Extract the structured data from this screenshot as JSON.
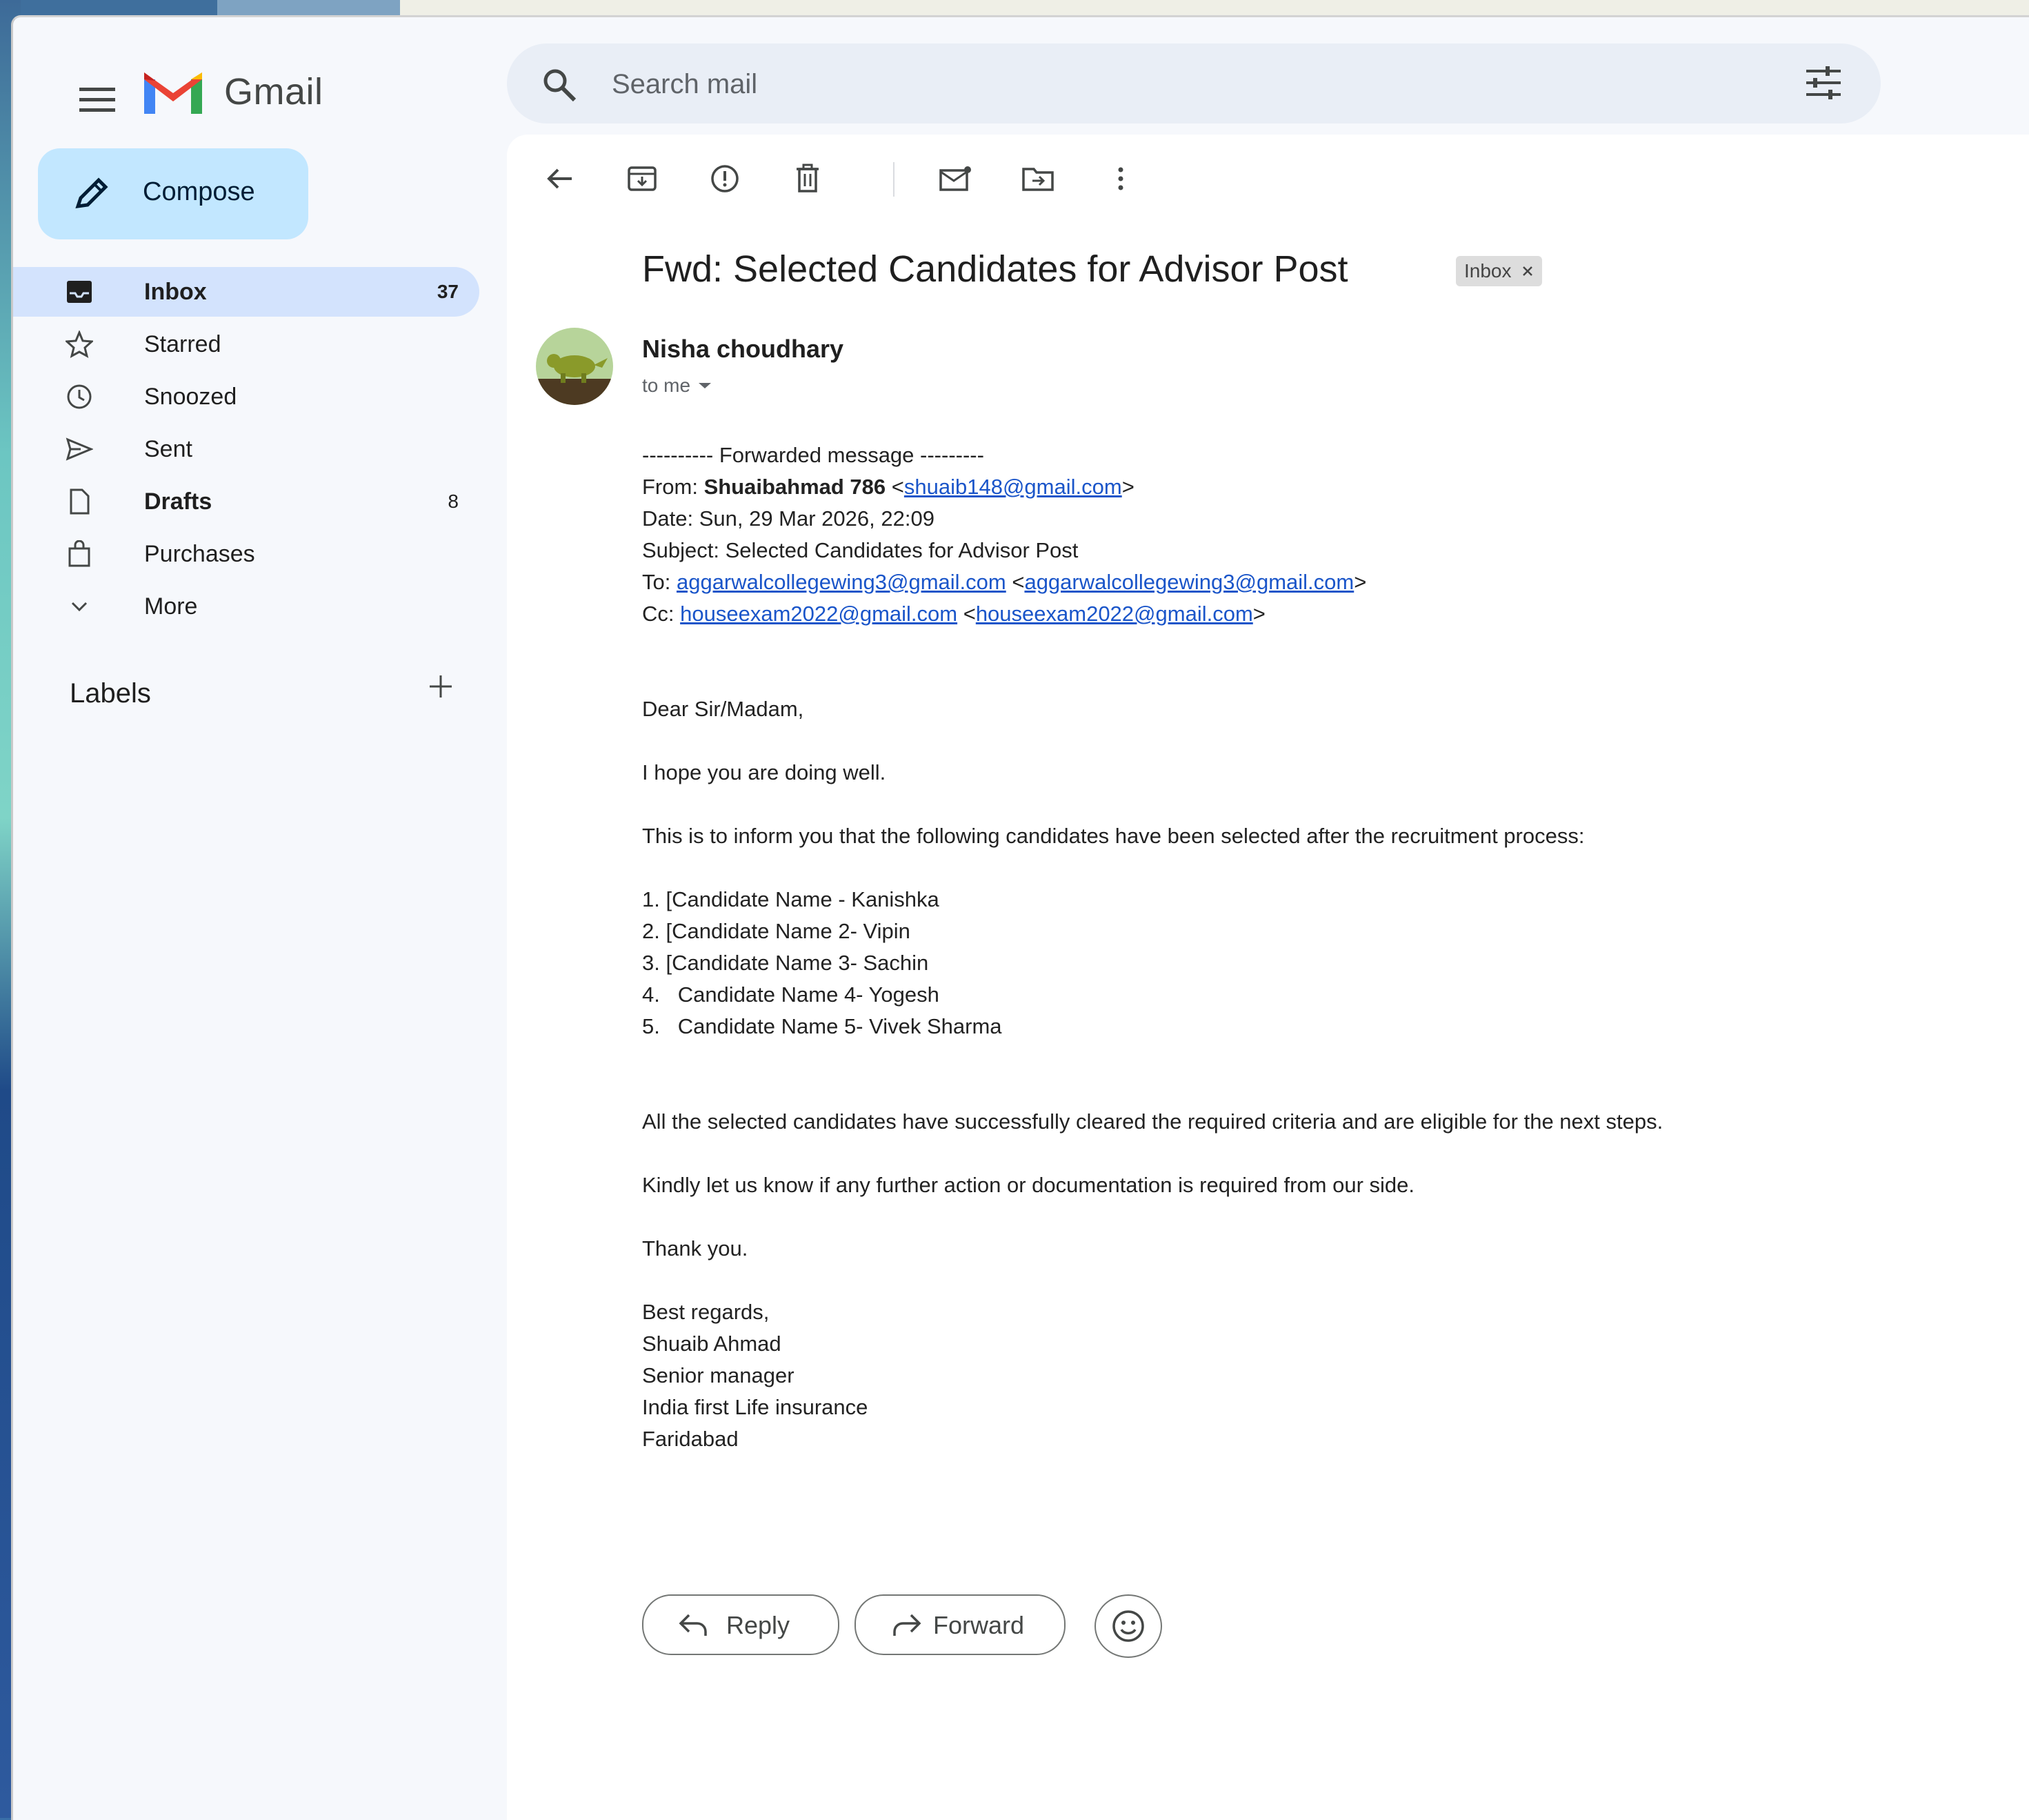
{
  "app": {
    "name": "Gmail"
  },
  "search": {
    "placeholder": "Search mail"
  },
  "sidebar": {
    "compose_label": "Compose",
    "items": [
      {
        "label": "Inbox",
        "count": "37",
        "icon": "inbox-icon"
      },
      {
        "label": "Starred",
        "count": "",
        "icon": "star-icon"
      },
      {
        "label": "Snoozed",
        "count": "",
        "icon": "clock-icon"
      },
      {
        "label": "Sent",
        "count": "",
        "icon": "send-icon"
      },
      {
        "label": "Drafts",
        "count": "8",
        "icon": "draft-icon"
      },
      {
        "label": "Purchases",
        "count": "",
        "icon": "bag-icon"
      },
      {
        "label": "More",
        "count": "",
        "icon": "chevron-down-icon"
      }
    ],
    "labels_heading": "Labels"
  },
  "email": {
    "subject": "Fwd: Selected Candidates for Advisor Post",
    "label_chip": "Inbox",
    "sender": "Nisha choudhary",
    "to": "to me",
    "forwarded": {
      "header": "---------- Forwarded message ---------",
      "from_prefix": "From: ",
      "from_name": "Shuaibahmad 786",
      "from_email": "shuaib148@gmail.com",
      "date": "Date: Sun, 29 Mar 2026, 22:09",
      "subject": "Subject: Selected Candidates for Advisor Post",
      "to_prefix": "To: ",
      "to_email": "aggarwalcollegewing3@gmail.com",
      "cc_prefix": "Cc: ",
      "cc_email": "houseexam2022@gmail.com"
    },
    "body": {
      "greeting": "Dear Sir/Madam,",
      "line1": "I hope you are doing well.",
      "line2": "This is to inform you that the following candidates have been selected after the recruitment process:",
      "candidates": [
        "1. [Candidate Name - Kanishka",
        "2. [Candidate Name 2- Vipin",
        "3. [Candidate Name 3- Sachin",
        "4.   Candidate Name 4- Yogesh",
        "5.   Candidate Name 5- Vivek Sharma"
      ],
      "line3": "All the selected candidates have successfully cleared the required criteria and are eligible for the next steps.",
      "line4": "Kindly let us know if any further action or documentation is required from our side.",
      "line5": "Thank you.",
      "signature": [
        "Best regards,",
        "Shuaib Ahmad",
        "Senior manager",
        "India first Life insurance",
        "Faridabad"
      ]
    },
    "actions": {
      "reply": "Reply",
      "forward": "Forward"
    }
  },
  "colors": {
    "accent": "#c2e7ff",
    "active_nav": "#d3e3fd",
    "link": "#1a55c9",
    "background": "#f6f8fc"
  }
}
